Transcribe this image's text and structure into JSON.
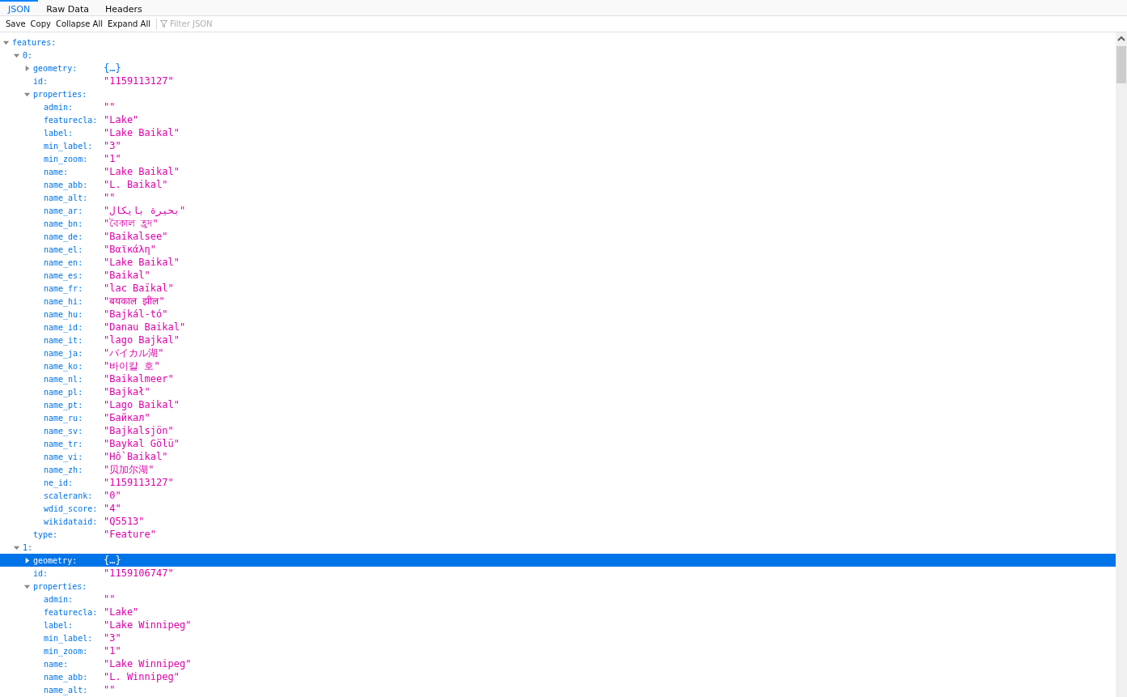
{
  "tabs": [
    {
      "label": "JSON",
      "selected": true
    },
    {
      "label": "Raw Data",
      "selected": false
    },
    {
      "label": "Headers",
      "selected": false
    }
  ],
  "toolbar": {
    "buttons": [
      "Save",
      "Copy",
      "Collapse All",
      "Expand All"
    ],
    "filter": {
      "placeholder": "Filter JSON"
    }
  },
  "tree": [
    {
      "key": "features:",
      "expanded": true,
      "selected": false,
      "children": [
        {
          "key": "0:",
          "expanded": true,
          "selected": false,
          "children": [
            {
              "key": "geometry:",
              "value": "{…}",
              "expanded": false,
              "selected": false
            },
            {
              "key": "id:",
              "value": "\"1159113127\"",
              "selected": false
            },
            {
              "key": "properties:",
              "expanded": true,
              "selected": false,
              "children": [
                {
                  "key": "admin:",
                  "value": "\"\"",
                  "selected": false
                },
                {
                  "key": "featurecla:",
                  "value": "\"Lake\"",
                  "selected": false
                },
                {
                  "key": "label:",
                  "value": "\"Lake Baikal\"",
                  "selected": false
                },
                {
                  "key": "min_label:",
                  "value": "\"3\"",
                  "selected": false
                },
                {
                  "key": "min_zoom:",
                  "value": "\"1\"",
                  "selected": false
                },
                {
                  "key": "name:",
                  "value": "\"Lake Baikal\"",
                  "selected": false
                },
                {
                  "key": "name_abb:",
                  "value": "\"L. Baikal\"",
                  "selected": false
                },
                {
                  "key": "name_alt:",
                  "value": "\"\"",
                  "selected": false
                },
                {
                  "key": "name_ar:",
                  "value": "\"بحيرة بايكال\"",
                  "selected": false
                },
                {
                  "key": "name_bn:",
                  "value": "\"বৈকাল হ্রদ\"",
                  "selected": false
                },
                {
                  "key": "name_de:",
                  "value": "\"Baikalsee\"",
                  "selected": false
                },
                {
                  "key": "name_el:",
                  "value": "\"Βαϊκάλη\"",
                  "selected": false
                },
                {
                  "key": "name_en:",
                  "value": "\"Lake Baikal\"",
                  "selected": false
                },
                {
                  "key": "name_es:",
                  "value": "\"Baikal\"",
                  "selected": false
                },
                {
                  "key": "name_fr:",
                  "value": "\"lac Baïkal\"",
                  "selected": false
                },
                {
                  "key": "name_hi:",
                  "value": "\"बयकाल झील\"",
                  "selected": false
                },
                {
                  "key": "name_hu:",
                  "value": "\"Bajkál-tó\"",
                  "selected": false
                },
                {
                  "key": "name_id:",
                  "value": "\"Danau Baikal\"",
                  "selected": false
                },
                {
                  "key": "name_it:",
                  "value": "\"lago Bajkal\"",
                  "selected": false
                },
                {
                  "key": "name_ja:",
                  "value": "\"バイカル湖\"",
                  "selected": false
                },
                {
                  "key": "name_ko:",
                  "value": "\"바이칼 호\"",
                  "selected": false
                },
                {
                  "key": "name_nl:",
                  "value": "\"Baikalmeer\"",
                  "selected": false
                },
                {
                  "key": "name_pl:",
                  "value": "\"Bajkał\"",
                  "selected": false
                },
                {
                  "key": "name_pt:",
                  "value": "\"Lago Baikal\"",
                  "selected": false
                },
                {
                  "key": "name_ru:",
                  "value": "\"Байкал\"",
                  "selected": false
                },
                {
                  "key": "name_sv:",
                  "value": "\"Bajkalsjön\"",
                  "selected": false
                },
                {
                  "key": "name_tr:",
                  "value": "\"Baykal Gölü\"",
                  "selected": false
                },
                {
                  "key": "name_vi:",
                  "value": "\"Hồ Baikal\"",
                  "selected": false
                },
                {
                  "key": "name_zh:",
                  "value": "\"贝加尔湖\"",
                  "selected": false
                },
                {
                  "key": "ne_id:",
                  "value": "\"1159113127\"",
                  "selected": false
                },
                {
                  "key": "scalerank:",
                  "value": "\"0\"",
                  "selected": false
                },
                {
                  "key": "wdid_score:",
                  "value": "\"4\"",
                  "selected": false
                },
                {
                  "key": "wikidataid:",
                  "value": "\"Q5513\"",
                  "selected": false
                }
              ]
            },
            {
              "key": "type:",
              "value": "\"Feature\"",
              "selected": false
            }
          ]
        },
        {
          "key": "1:",
          "expanded": true,
          "selected": false,
          "children": [
            {
              "key": "geometry:",
              "value": "{…}",
              "expanded": false,
              "selected": true
            },
            {
              "key": "id:",
              "value": "\"1159106747\"",
              "selected": false
            },
            {
              "key": "properties:",
              "expanded": true,
              "selected": false,
              "children": [
                {
                  "key": "admin:",
                  "value": "\"\"",
                  "selected": false
                },
                {
                  "key": "featurecla:",
                  "value": "\"Lake\"",
                  "selected": false
                },
                {
                  "key": "label:",
                  "value": "\"Lake Winnipeg\"",
                  "selected": false
                },
                {
                  "key": "min_label:",
                  "value": "\"3\"",
                  "selected": false
                },
                {
                  "key": "min_zoom:",
                  "value": "\"1\"",
                  "selected": false
                },
                {
                  "key": "name:",
                  "value": "\"Lake Winnipeg\"",
                  "selected": false
                },
                {
                  "key": "name_abb:",
                  "value": "\"L. Winnipeg\"",
                  "selected": false
                },
                {
                  "key": "name_alt:",
                  "value": "\"\"",
                  "selected": false
                }
              ]
            }
          ]
        }
      ]
    }
  ]
}
